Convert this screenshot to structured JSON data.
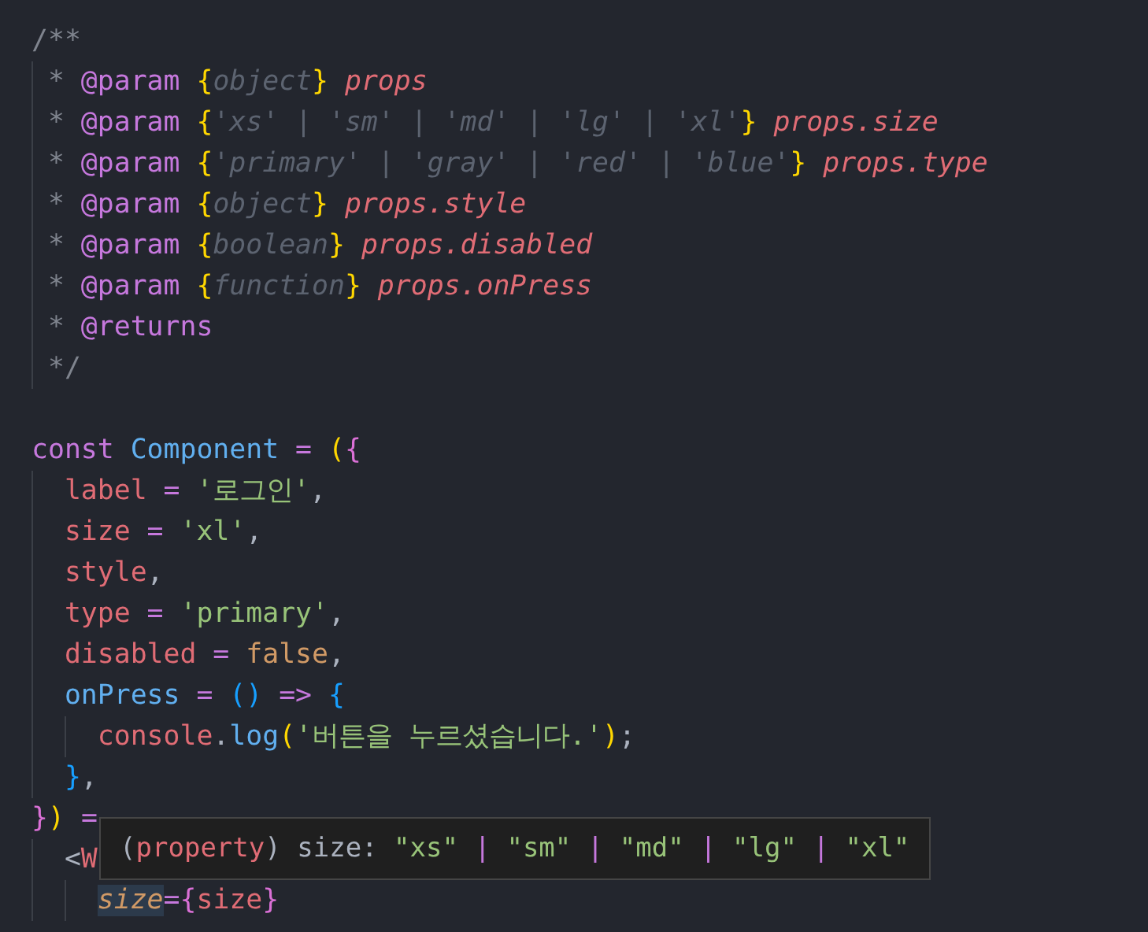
{
  "editor": {
    "lines": [
      {
        "kind": "code",
        "tokens": [
          {
            "text": "/**",
            "kind": "comment"
          }
        ]
      },
      {
        "kind": "code",
        "tokens": [
          {
            "text": " * ",
            "kind": "comment"
          },
          {
            "text": "@param ",
            "kind": "tag"
          },
          {
            "text": "{",
            "kind": "brace"
          },
          {
            "text": "object",
            "kind": "type"
          },
          {
            "text": "} ",
            "kind": "brace"
          },
          {
            "text": "props",
            "kind": "param"
          }
        ]
      },
      {
        "kind": "code",
        "tokens": [
          {
            "text": " * ",
            "kind": "comment"
          },
          {
            "text": "@param ",
            "kind": "tag"
          },
          {
            "text": "{",
            "kind": "brace"
          },
          {
            "text": "'xs' | 'sm' | 'md' | 'lg' | 'xl'",
            "kind": "type"
          },
          {
            "text": "} ",
            "kind": "brace"
          },
          {
            "text": "props.size",
            "kind": "param"
          }
        ]
      },
      {
        "kind": "code",
        "tokens": [
          {
            "text": " * ",
            "kind": "comment"
          },
          {
            "text": "@param ",
            "kind": "tag"
          },
          {
            "text": "{",
            "kind": "brace"
          },
          {
            "text": "'primary' | 'gray' | 'red' | 'blue'",
            "kind": "type"
          },
          {
            "text": "} ",
            "kind": "brace"
          },
          {
            "text": "props.type",
            "kind": "param"
          }
        ]
      },
      {
        "kind": "code",
        "tokens": [
          {
            "text": " * ",
            "kind": "comment"
          },
          {
            "text": "@param ",
            "kind": "tag"
          },
          {
            "text": "{",
            "kind": "brace"
          },
          {
            "text": "object",
            "kind": "type"
          },
          {
            "text": "} ",
            "kind": "brace"
          },
          {
            "text": "props.style",
            "kind": "param"
          }
        ]
      },
      {
        "kind": "code",
        "tokens": [
          {
            "text": " * ",
            "kind": "comment"
          },
          {
            "text": "@param ",
            "kind": "tag"
          },
          {
            "text": "{",
            "kind": "brace"
          },
          {
            "text": "boolean",
            "kind": "type"
          },
          {
            "text": "} ",
            "kind": "brace"
          },
          {
            "text": "props.disabled",
            "kind": "param"
          }
        ]
      },
      {
        "kind": "code",
        "tokens": [
          {
            "text": " * ",
            "kind": "comment"
          },
          {
            "text": "@param ",
            "kind": "tag"
          },
          {
            "text": "{",
            "kind": "brace"
          },
          {
            "text": "function",
            "kind": "type"
          },
          {
            "text": "} ",
            "kind": "brace"
          },
          {
            "text": "props.onPress",
            "kind": "param"
          }
        ]
      },
      {
        "kind": "code",
        "tokens": [
          {
            "text": " * ",
            "kind": "comment"
          },
          {
            "text": "@returns",
            "kind": "tag"
          }
        ]
      },
      {
        "kind": "code",
        "tokens": [
          {
            "text": " */",
            "kind": "comment"
          }
        ]
      },
      {
        "kind": "blank"
      },
      {
        "kind": "code",
        "tokens": [
          {
            "text": "const ",
            "kind": "keyword"
          },
          {
            "text": "Component",
            "kind": "class"
          },
          {
            "text": " = ",
            "kind": "op"
          },
          {
            "text": "(",
            "kind": "bracket1"
          },
          {
            "text": "{",
            "kind": "bracket2"
          }
        ]
      },
      {
        "kind": "code",
        "tokens": [
          {
            "text": "  label",
            "kind": "var"
          },
          {
            "text": " = ",
            "kind": "op"
          },
          {
            "text": "'로그인'",
            "kind": "string"
          },
          {
            "text": ",",
            "kind": "plain"
          }
        ]
      },
      {
        "kind": "code",
        "tokens": [
          {
            "text": "  size",
            "kind": "var"
          },
          {
            "text": " = ",
            "kind": "op"
          },
          {
            "text": "'xl'",
            "kind": "string"
          },
          {
            "text": ",",
            "kind": "plain"
          }
        ]
      },
      {
        "kind": "code",
        "tokens": [
          {
            "text": "  style",
            "kind": "var"
          },
          {
            "text": ",",
            "kind": "plain"
          }
        ]
      },
      {
        "kind": "code",
        "tokens": [
          {
            "text": "  type",
            "kind": "var"
          },
          {
            "text": " = ",
            "kind": "op"
          },
          {
            "text": "'primary'",
            "kind": "string"
          },
          {
            "text": ",",
            "kind": "plain"
          }
        ]
      },
      {
        "kind": "code",
        "tokens": [
          {
            "text": "  disabled",
            "kind": "var"
          },
          {
            "text": " = ",
            "kind": "op"
          },
          {
            "text": "false",
            "kind": "bool"
          },
          {
            "text": ",",
            "kind": "plain"
          }
        ]
      },
      {
        "kind": "code",
        "tokens": [
          {
            "text": "  onPress",
            "kind": "func"
          },
          {
            "text": " = ",
            "kind": "op"
          },
          {
            "text": "()",
            "kind": "bracket3"
          },
          {
            "text": " => ",
            "kind": "op"
          },
          {
            "text": "{",
            "kind": "bracket3"
          }
        ]
      },
      {
        "kind": "code",
        "tokens": [
          {
            "text": "    console",
            "kind": "var"
          },
          {
            "text": ".",
            "kind": "plain"
          },
          {
            "text": "log",
            "kind": "func"
          },
          {
            "text": "(",
            "kind": "bracket1"
          },
          {
            "text": "'버튼을 누르셨습니다.'",
            "kind": "string"
          },
          {
            "text": ")",
            "kind": "bracket1"
          },
          {
            "text": ";",
            "kind": "plain"
          }
        ]
      },
      {
        "kind": "code",
        "tokens": [
          {
            "text": "  }",
            "kind": "bracket3"
          },
          {
            "text": ",",
            "kind": "plain"
          }
        ]
      },
      {
        "kind": "code",
        "tokens": [
          {
            "text": "}",
            "kind": "bracket2"
          },
          {
            "text": ")",
            "kind": "bracket1"
          },
          {
            "text": " =",
            "kind": "op"
          }
        ]
      },
      {
        "kind": "code",
        "tokens": [
          {
            "text": "  <",
            "kind": "plain"
          },
          {
            "text": "W",
            "kind": "var"
          }
        ]
      },
      {
        "kind": "code",
        "tokens": [
          {
            "text": "    size",
            "kind": "attr",
            "highlighted": true
          },
          {
            "text": "=",
            "kind": "op"
          },
          {
            "text": "{",
            "kind": "bracket2"
          },
          {
            "text": "size",
            "kind": "var"
          },
          {
            "text": "}",
            "kind": "bracket2"
          }
        ]
      }
    ]
  },
  "tooltip": {
    "tokens": [
      {
        "text": "(",
        "kind": "plain"
      },
      {
        "text": "property",
        "kind": "var"
      },
      {
        "text": ") size: ",
        "kind": "plain"
      },
      {
        "text": "\"xs\"",
        "kind": "string"
      },
      {
        "text": " | ",
        "kind": "op"
      },
      {
        "text": "\"sm\"",
        "kind": "string"
      },
      {
        "text": " | ",
        "kind": "op"
      },
      {
        "text": "\"md\"",
        "kind": "string"
      },
      {
        "text": " | ",
        "kind": "op"
      },
      {
        "text": "\"lg\"",
        "kind": "string"
      },
      {
        "text": " | ",
        "kind": "op"
      },
      {
        "text": "\"xl\"",
        "kind": "string"
      }
    ]
  }
}
